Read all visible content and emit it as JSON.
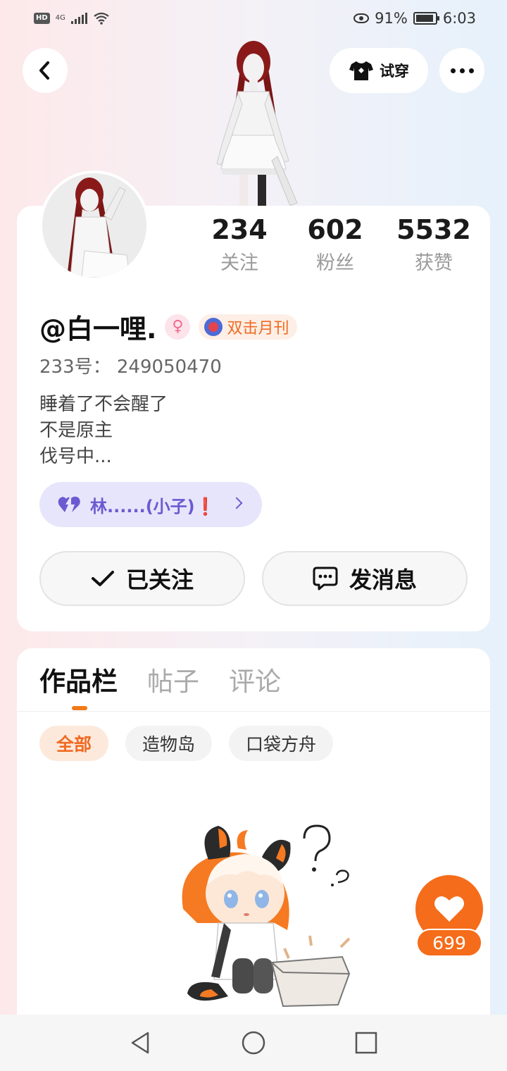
{
  "status_bar": {
    "hd": "HD",
    "network": "4G",
    "battery": "91%",
    "time": "6:03"
  },
  "header": {
    "tryon_label": "试穿"
  },
  "profile": {
    "stats": [
      {
        "value": "234",
        "label": "关注"
      },
      {
        "value": "602",
        "label": "粉丝"
      },
      {
        "value": "5532",
        "label": "获赞"
      }
    ],
    "username": "@白一哩.",
    "gender_symbol": "♀",
    "title_badge": "双击月刊",
    "uid": "233号： 249050470",
    "bio": [
      "睡着了不会醒了",
      "不是原主",
      "伐号中..."
    ],
    "relation": "林......(小子)❗",
    "follow_button": "已关注",
    "message_button": "发消息"
  },
  "works": {
    "tabs": [
      "作品栏",
      "帖子",
      "评论"
    ],
    "filters": [
      "全部",
      "造物岛",
      "口袋方舟"
    ]
  },
  "like": {
    "count": "699"
  },
  "colors": {
    "accent": "#f56c1a",
    "relation_bg": "#e7e5fb",
    "relation_text": "#6a5bd0"
  },
  "icons": {
    "back": "chevron-left-icon",
    "tryon": "tshirt-icon",
    "more": "more-dots-icon",
    "follow": "check-icon",
    "message": "chat-bubble-icon",
    "relation": "heart-icon",
    "like": "heart-icon"
  }
}
